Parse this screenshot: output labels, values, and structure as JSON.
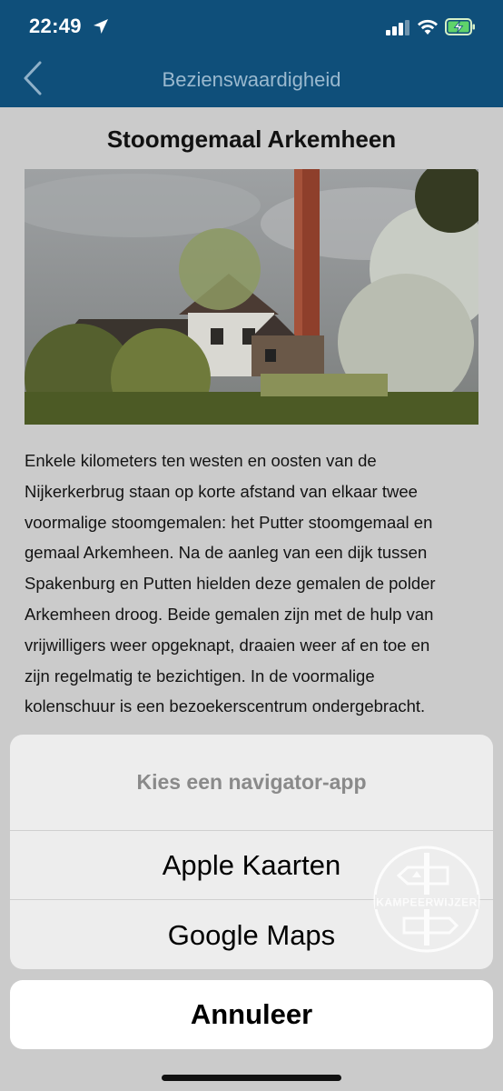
{
  "status_bar": {
    "time": "22:49",
    "location_icon": "location-arrow-icon",
    "signal_icon": "cellular-signal-icon",
    "wifi_icon": "wifi-icon",
    "battery_icon": "battery-charging-icon"
  },
  "nav": {
    "back_icon": "chevron-left-icon",
    "title": "Bezienswaardigheid"
  },
  "page": {
    "title": "Stoomgemaal Arkemheen",
    "body_lines": [
      "Enkele kilometers ten westen en oosten van de",
      "Nijkerkerbrug staan op korte afstand van elkaar twee",
      "voormalige stoomgemalen: het Putter stoomgemaal en",
      "gemaal Arkemheen. Na de aanleg van een dijk tussen",
      "Spakenburg en Putten hielden deze gemalen de polder",
      "Arkemheen droog. Beide gemalen zijn met de hulp van",
      "vrijwilligers weer opgeknapt, draaien weer af en toe en",
      "zijn regelmatig te bezichtigen. In de voormalige",
      "kolenschuur is een bezoekerscentrum ondergebracht."
    ]
  },
  "action_sheet": {
    "title": "Kies een navigator-app",
    "options": [
      "Apple Kaarten",
      "Google Maps"
    ],
    "cancel_label": "Annuleer",
    "watermark_text": "KAMPEERWIJZER"
  },
  "colors": {
    "header_bg": "#0f4f7a",
    "nav_title": "#9ab9cf",
    "dim_background": "#cbcbcb",
    "sheet_bg": "#ededed"
  }
}
